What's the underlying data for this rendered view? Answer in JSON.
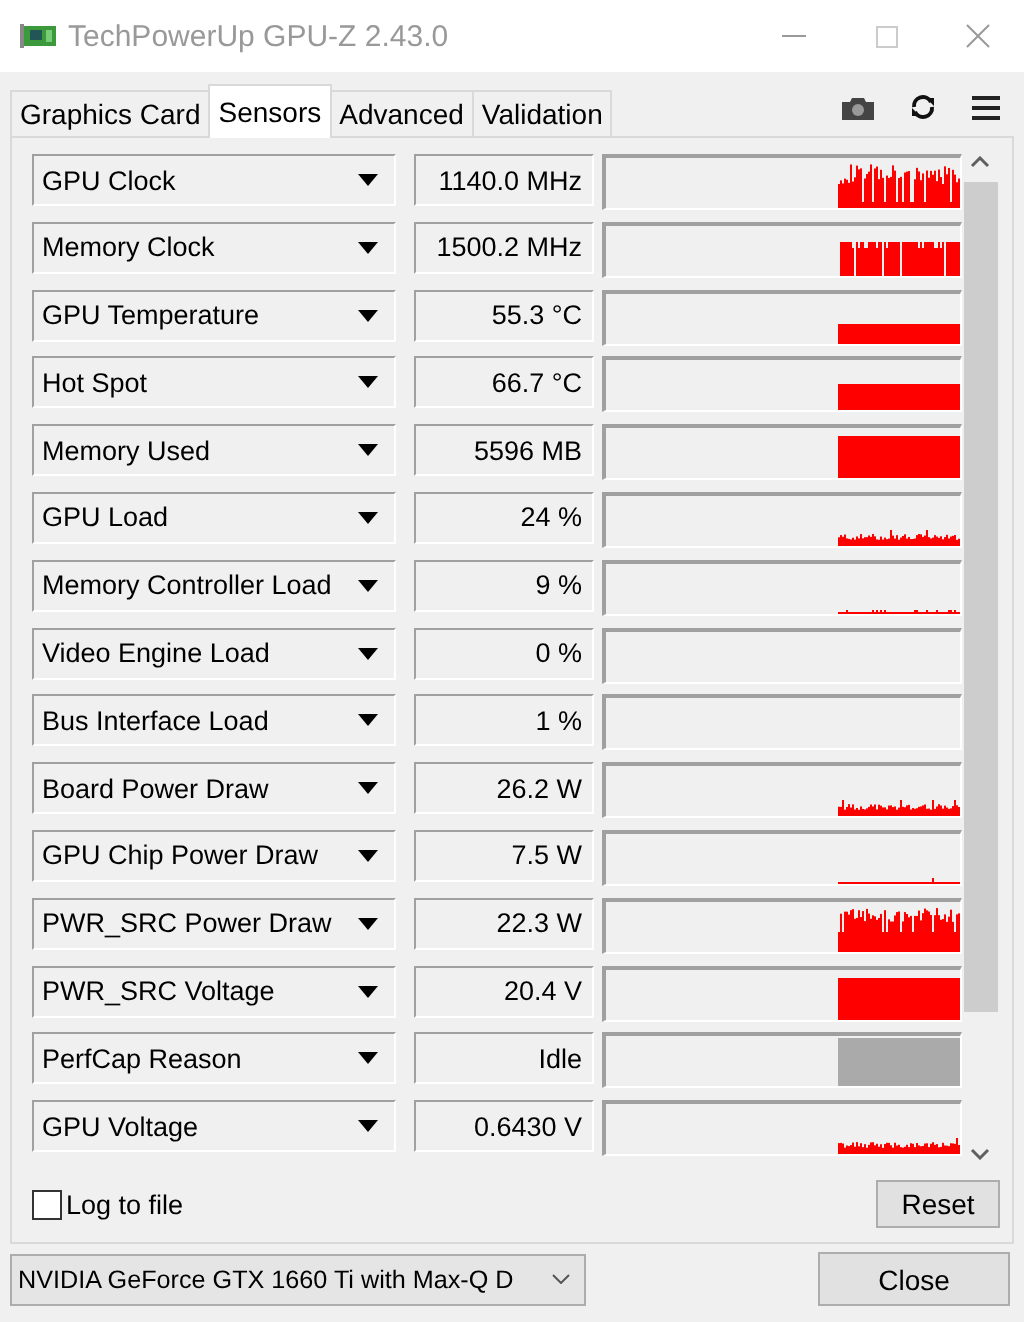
{
  "window": {
    "title": "TechPowerUp GPU-Z 2.43.0"
  },
  "tabs": [
    {
      "label": "Graphics Card",
      "selected": false
    },
    {
      "label": "Sensors",
      "selected": true
    },
    {
      "label": "Advanced",
      "selected": false
    },
    {
      "label": "Validation",
      "selected": false
    }
  ],
  "sensors": [
    {
      "name": "GPU Clock",
      "reading": "1140.0 MHz",
      "graph": {
        "kind": "spiky"
      }
    },
    {
      "name": "Memory Clock",
      "reading": "1500.2 MHz",
      "graph": {
        "kind": "gapped"
      }
    },
    {
      "name": "GPU Temperature",
      "reading": "55.3 °C",
      "graph": {
        "kind": "low"
      }
    },
    {
      "name": "Hot Spot",
      "reading": "66.7 °C",
      "graph": {
        "kind": "mid"
      }
    },
    {
      "name": "Memory Used",
      "reading": "5596 MB",
      "graph": {
        "kind": "high"
      }
    },
    {
      "name": "GPU Load",
      "reading": "24 %",
      "graph": {
        "kind": "noise"
      }
    },
    {
      "name": "Memory Controller Load",
      "reading": "9 %",
      "graph": {
        "kind": "trace"
      }
    },
    {
      "name": "Video Engine Load",
      "reading": "0 %",
      "graph": {
        "kind": "empty"
      }
    },
    {
      "name": "Bus Interface Load",
      "reading": "1 %",
      "graph": {
        "kind": "empty"
      }
    },
    {
      "name": "Board Power Draw",
      "reading": "26.2 W",
      "graph": {
        "kind": "noise"
      }
    },
    {
      "name": "GPU Chip Power Draw",
      "reading": "7.5 W",
      "graph": {
        "kind": "line"
      }
    },
    {
      "name": "PWR_SRC Power Draw",
      "reading": "22.3 W",
      "graph": {
        "kind": "jagged"
      }
    },
    {
      "name": "PWR_SRC Voltage",
      "reading": "20.4 V",
      "graph": {
        "kind": "high"
      }
    },
    {
      "name": "PerfCap Reason",
      "reading": "Idle",
      "graph": {
        "kind": "gray"
      }
    },
    {
      "name": "GPU Voltage",
      "reading": "0.6430 V",
      "graph": {
        "kind": "noise"
      }
    }
  ],
  "log_to_file": {
    "label": "Log to file",
    "checked": false
  },
  "reset_button": "Reset",
  "device_select": {
    "value": "NVIDIA GeForce GTX 1660 Ti with Max-Q D"
  },
  "close_button": "Close"
}
